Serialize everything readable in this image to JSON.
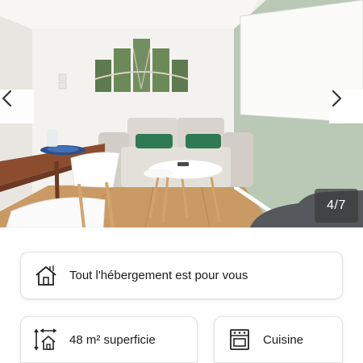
{
  "gallery": {
    "counter": "4/7",
    "prev_icon": "chevron-left-icon",
    "next_icon": "chevron-right-icon"
  },
  "amenities": [
    {
      "icon": "house-icon",
      "label": "Tout l'hébergement est pour vous"
    },
    {
      "icon": "area-icon",
      "label": "48 m² superficie"
    },
    {
      "icon": "oven-icon",
      "label": "Cuisine"
    }
  ],
  "colors": {
    "wall_green": "#b9c9b5",
    "sofa": "#dcd8d1",
    "cushion": "#2f7a55",
    "floor": "#c99a64",
    "counter_bg": "#3c3c3c",
    "card_border": "#e3e3e3"
  }
}
